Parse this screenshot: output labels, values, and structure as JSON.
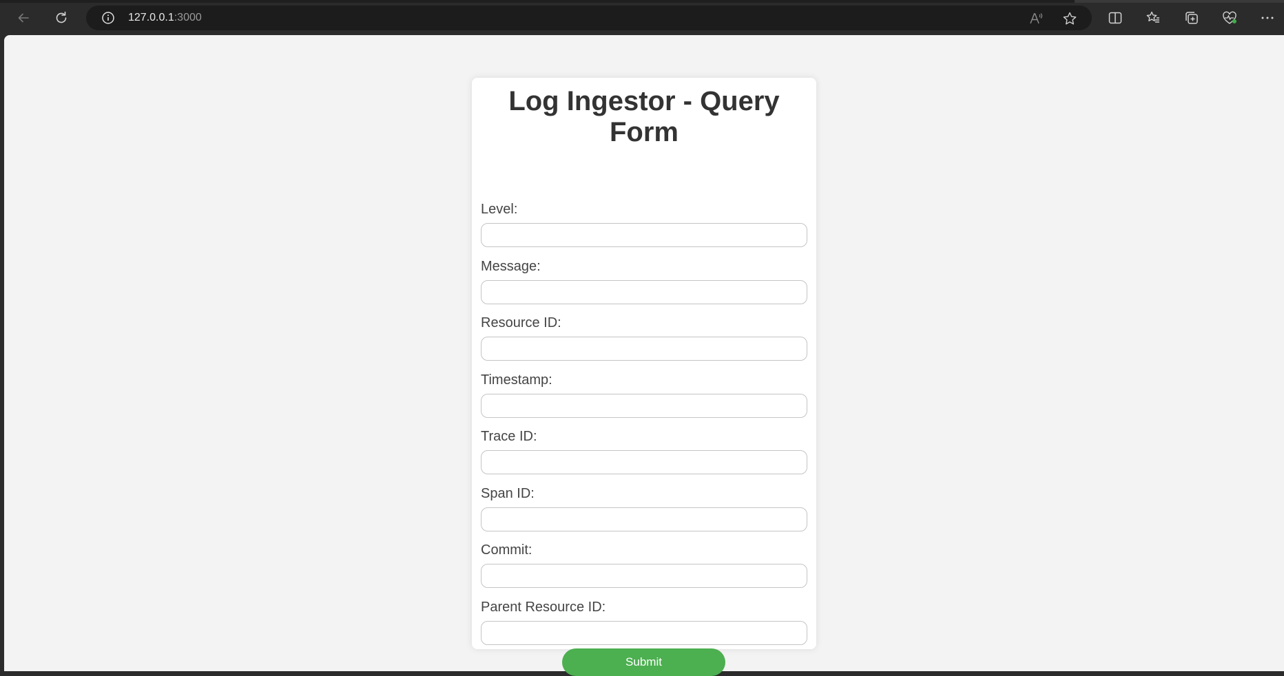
{
  "browser": {
    "url_host": "127.0.0.1",
    "url_port": ":3000",
    "icons": [
      "back-icon",
      "refresh-icon",
      "site-info-icon",
      "read-aloud-icon",
      "favorite-star-icon",
      "split-screen-icon",
      "favorites-icon",
      "collections-icon",
      "browser-essentials-icon",
      "more-icon"
    ]
  },
  "form": {
    "title": "Log Ingestor - Query Form",
    "fields": [
      {
        "label": "Level:",
        "value": ""
      },
      {
        "label": "Message:",
        "value": ""
      },
      {
        "label": "Resource ID:",
        "value": ""
      },
      {
        "label": "Timestamp:",
        "value": ""
      },
      {
        "label": "Trace ID:",
        "value": ""
      },
      {
        "label": "Span ID:",
        "value": ""
      },
      {
        "label": "Commit:",
        "value": ""
      },
      {
        "label": "Parent Resource ID:",
        "value": ""
      }
    ],
    "submit_label": "Submit"
  },
  "colors": {
    "accent": "#4caf50",
    "page_background": "#f3f3f3",
    "card_background": "#ffffff",
    "title_text": "#333333"
  }
}
